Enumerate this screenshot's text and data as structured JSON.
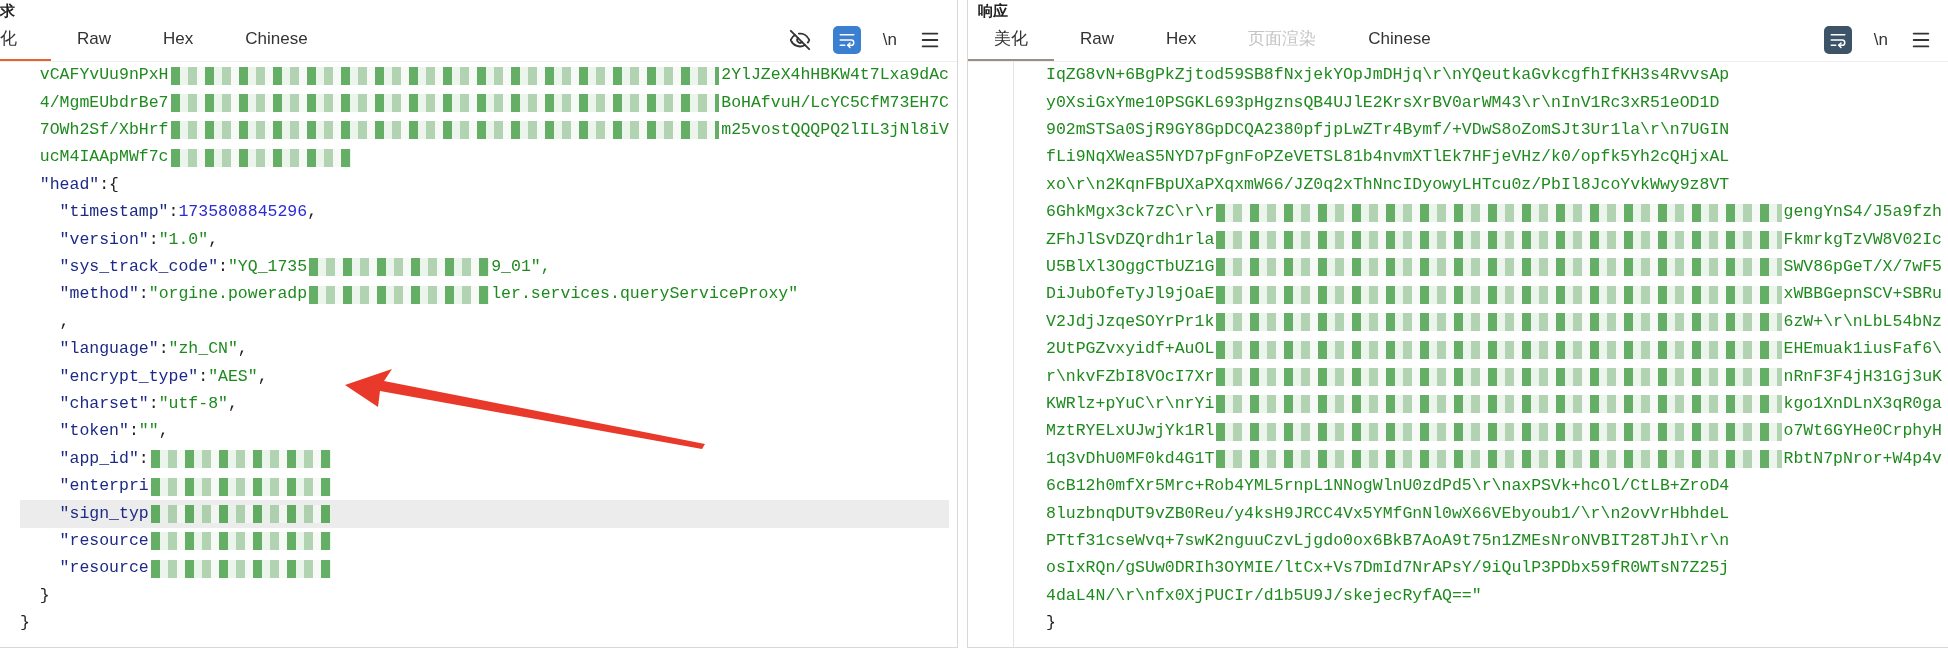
{
  "panels": [
    {
      "title": "求",
      "focused": true,
      "tabs": [
        {
          "label": "化",
          "selected": true,
          "disabled": false
        },
        {
          "label": "Raw",
          "selected": false,
          "disabled": false
        },
        {
          "label": "Hex",
          "selected": false,
          "disabled": false
        },
        {
          "label": "Chinese",
          "selected": false,
          "disabled": false
        }
      ],
      "toolbar": [
        {
          "kind": "eye"
        },
        {
          "kind": "wrap",
          "on": true
        },
        {
          "kind": "text",
          "text": "\\n"
        },
        {
          "kind": "menu"
        }
      ],
      "lines": [
        {
          "highlighted": false,
          "parts": [
            {
              "kind": "string",
              "text": "  vCAFYvUu9nPxH"
            },
            {
              "kind": "redacted"
            },
            {
              "kind": "string",
              "text": "2YlJZeX4hHBKW4t7Lxa9dAc"
            }
          ]
        },
        {
          "highlighted": false,
          "parts": [
            {
              "kind": "string",
              "text": "  4/MgmEUbdrBe7"
            },
            {
              "kind": "redacted"
            },
            {
              "kind": "string",
              "text": "BoHAfvuH/LcYC5CfM73EH7C"
            }
          ]
        },
        {
          "highlighted": false,
          "parts": [
            {
              "kind": "string",
              "text": "  7OWh2Sf/XbHrf"
            },
            {
              "kind": "redacted"
            },
            {
              "kind": "string",
              "text": "m25vostQQQPQ2lIL3jNl8iV"
            }
          ]
        },
        {
          "highlighted": false,
          "parts": [
            {
              "kind": "string",
              "text": "  ucM4IAApMWf7c"
            },
            {
              "kind": "redacted_short"
            }
          ]
        },
        {
          "highlighted": false,
          "parts": [
            {
              "kind": "key",
              "text": "  \"head\""
            },
            {
              "kind": "punct",
              "text": ":{"
            }
          ]
        },
        {
          "highlighted": false,
          "parts": [
            {
              "kind": "key",
              "text": "    \"timestamp\""
            },
            {
              "kind": "punct",
              "text": ":"
            },
            {
              "kind": "number",
              "text": "1735808845296"
            },
            {
              "kind": "punct",
              "text": ","
            }
          ]
        },
        {
          "highlighted": false,
          "parts": [
            {
              "kind": "key",
              "text": "    \"version\""
            },
            {
              "kind": "punct",
              "text": ":"
            },
            {
              "kind": "string",
              "text": "\"1.0\""
            },
            {
              "kind": "punct",
              "text": ","
            }
          ]
        },
        {
          "highlighted": false,
          "parts": [
            {
              "kind": "key",
              "text": "    \"sys_track_code\""
            },
            {
              "kind": "punct",
              "text": ":"
            },
            {
              "kind": "string",
              "text": "\"YQ_1735"
            },
            {
              "kind": "redacted_short"
            },
            {
              "kind": "string",
              "text": "9_01\","
            }
          ]
        },
        {
          "highlighted": false,
          "parts": [
            {
              "kind": "key",
              "text": "    \"method\""
            },
            {
              "kind": "punct",
              "text": ":"
            },
            {
              "kind": "string",
              "text": "\"orgine.poweradp"
            },
            {
              "kind": "redacted_short"
            },
            {
              "kind": "string",
              "text": "ler.services.queryServiceProxy\""
            }
          ]
        },
        {
          "highlighted": false,
          "parts": [
            {
              "kind": "punct",
              "text": "    ,"
            }
          ]
        },
        {
          "highlighted": false,
          "parts": [
            {
              "kind": "key",
              "text": "    \"language\""
            },
            {
              "kind": "punct",
              "text": ":"
            },
            {
              "kind": "string",
              "text": "\"zh_CN\""
            },
            {
              "kind": "punct",
              "text": ","
            }
          ]
        },
        {
          "highlighted": false,
          "parts": [
            {
              "kind": "key",
              "text": "    \"encrypt_type\""
            },
            {
              "kind": "punct",
              "text": ":"
            },
            {
              "kind": "string",
              "text": "\"AES\""
            },
            {
              "kind": "punct",
              "text": ","
            }
          ]
        },
        {
          "highlighted": false,
          "parts": [
            {
              "kind": "key",
              "text": "    \"charset\""
            },
            {
              "kind": "punct",
              "text": ":"
            },
            {
              "kind": "string",
              "text": "\"utf-8\""
            },
            {
              "kind": "punct",
              "text": ","
            }
          ]
        },
        {
          "highlighted": false,
          "parts": [
            {
              "kind": "key",
              "text": "    \"token\""
            },
            {
              "kind": "punct",
              "text": ":"
            },
            {
              "kind": "string",
              "text": "\"\""
            },
            {
              "kind": "punct",
              "text": ","
            }
          ]
        },
        {
          "highlighted": false,
          "parts": [
            {
              "kind": "key",
              "text": "    \"app_id\""
            },
            {
              "kind": "punct",
              "text": ":"
            },
            {
              "kind": "redacted_short"
            }
          ]
        },
        {
          "highlighted": false,
          "parts": [
            {
              "kind": "key",
              "text": "    \"enterpri"
            },
            {
              "kind": "redacted_short"
            }
          ]
        },
        {
          "highlighted": true,
          "parts": [
            {
              "kind": "key",
              "text": "    \"sign_typ"
            },
            {
              "kind": "redacted_short"
            }
          ]
        },
        {
          "highlighted": false,
          "parts": [
            {
              "kind": "key",
              "text": "    \"resource"
            },
            {
              "kind": "redacted_short"
            }
          ]
        },
        {
          "highlighted": false,
          "parts": [
            {
              "kind": "key",
              "text": "    \"resource"
            },
            {
              "kind": "redacted_short"
            }
          ]
        },
        {
          "highlighted": false,
          "parts": [
            {
              "kind": "punct",
              "text": "  }"
            }
          ]
        },
        {
          "highlighted": false,
          "parts": [
            {
              "kind": "punct",
              "text": "}"
            }
          ]
        }
      ]
    },
    {
      "title": "响应",
      "focused": false,
      "tabs": [
        {
          "label": "美化",
          "selected": true,
          "disabled": false
        },
        {
          "label": "Raw",
          "selected": false,
          "disabled": false
        },
        {
          "label": "Hex",
          "selected": false,
          "disabled": false
        },
        {
          "label": "页面渲染",
          "selected": false,
          "disabled": true
        },
        {
          "label": "Chinese",
          "selected": false,
          "disabled": false
        }
      ],
      "toolbar": [
        {
          "kind": "wrap",
          "on": true
        },
        {
          "kind": "text",
          "text": "\\n"
        },
        {
          "kind": "menu"
        }
      ],
      "lines": [
        {
          "highlighted": false,
          "parts": [
            {
              "kind": "string",
              "text": "IqZG8vN+6BgPkZjtod59SB8fNxjekYOpJmDHjq\\r\\nYQeutkaGvkcgfhIfKH3s4RvvsAp"
            }
          ]
        },
        {
          "highlighted": false,
          "parts": [
            {
              "kind": "string",
              "text": "y0XsiGxYme10PSGKL693pHgznsQB4UJlE2KrsXrBV0arWM43\\r\\nInV1Rc3xR51eOD1D"
            }
          ]
        },
        {
          "highlighted": false,
          "parts": [
            {
              "kind": "string",
              "text": "902mSTSa0SjR9GY8GpDCQA2380pfjpLwZTr4Bymf/+VDwS8oZomSJt3Ur1la\\r\\n7UGIN"
            }
          ]
        },
        {
          "highlighted": false,
          "parts": [
            {
              "kind": "string",
              "text": "fLi9NqXWeaS5NYD7pFgnFoPZeVETSL81b4nvmXTlEk7HFjeVHz/k0/opfk5Yh2cQHjxAL"
            }
          ]
        },
        {
          "highlighted": false,
          "parts": [
            {
              "kind": "string",
              "text": "xo\\r\\n2KqnFBpUXaPXqxmW66/JZ0q2xThNncIDyowyLHTcu0z/PbIl8JcoYvkWwy9z8VT"
            }
          ]
        },
        {
          "highlighted": false,
          "parts": [
            {
              "kind": "string",
              "text": "6GhkMgx3ck7zC\\r\\r"
            },
            {
              "kind": "redacted"
            },
            {
              "kind": "string",
              "text": "gengYnS4/J5a9fzh"
            }
          ]
        },
        {
          "highlighted": false,
          "parts": [
            {
              "kind": "string",
              "text": "ZFhJlSvDZQrdh1rla"
            },
            {
              "kind": "redacted"
            },
            {
              "kind": "string",
              "text": "FkmrkgTzVW8V02Ic"
            }
          ]
        },
        {
          "highlighted": false,
          "parts": [
            {
              "kind": "string",
              "text": "U5BlXl3OggCTbUZ1G"
            },
            {
              "kind": "redacted"
            },
            {
              "kind": "string",
              "text": "SWV86pGeT/X/7wF5"
            }
          ]
        },
        {
          "highlighted": false,
          "parts": [
            {
              "kind": "string",
              "text": "DiJubOfeTyJl9jOaE"
            },
            {
              "kind": "redacted"
            },
            {
              "kind": "string",
              "text": "xWBBGepnSCV+SBRu"
            }
          ]
        },
        {
          "highlighted": false,
          "parts": [
            {
              "kind": "string",
              "text": "V2JdjJzqeSOYrPr1k"
            },
            {
              "kind": "redacted"
            },
            {
              "kind": "string",
              "text": "6zW+\\r\\nLbL54bNz"
            }
          ]
        },
        {
          "highlighted": false,
          "parts": [
            {
              "kind": "string",
              "text": "2UtPGZvxyidf+AuOL"
            },
            {
              "kind": "redacted"
            },
            {
              "kind": "string",
              "text": "EHEmuak1iusFaf6\\"
            }
          ]
        },
        {
          "highlighted": false,
          "parts": [
            {
              "kind": "string",
              "text": "r\\nkvFZbI8VOcI7Xr"
            },
            {
              "kind": "redacted"
            },
            {
              "kind": "string",
              "text": "nRnF3F4jH31Gj3uK"
            }
          ]
        },
        {
          "highlighted": false,
          "parts": [
            {
              "kind": "string",
              "text": "KWRlz+pYuC\\r\\nrYi"
            },
            {
              "kind": "redacted"
            },
            {
              "kind": "string",
              "text": "kgo1XnDLnX3qR0ga"
            }
          ]
        },
        {
          "highlighted": false,
          "parts": [
            {
              "kind": "string",
              "text": "MztRYELxUJwjYk1Rl"
            },
            {
              "kind": "redacted"
            },
            {
              "kind": "string",
              "text": "o7Wt6GYHe0CrphyH"
            }
          ]
        },
        {
          "highlighted": false,
          "parts": [
            {
              "kind": "string",
              "text": "1q3vDhU0MF0kd4G1T"
            },
            {
              "kind": "redacted"
            },
            {
              "kind": "string",
              "text": "RbtN7pNror+W4p4v"
            }
          ]
        },
        {
          "highlighted": false,
          "parts": [
            {
              "kind": "string",
              "text": "6cB12h0mfXr5Mrc+Rob4YML5rnpL1NNogWlnU0zdPd5\\r\\naxPSVk+hcOl/CtLB+ZroD4"
            }
          ]
        },
        {
          "highlighted": false,
          "parts": [
            {
              "kind": "string",
              "text": "8luzbnqDUT9vZB0Reu/y4ksH9JRCC4Vx5YMfGnNl0wX66VEbyoub1/\\r\\n2ovVrHbhdeL"
            }
          ]
        },
        {
          "highlighted": false,
          "parts": [
            {
              "kind": "string",
              "text": "PTtf31cseWvq+7swK2nguuCzvLjgdo0ox6BkB7AoA9t75n1ZMEsNroNVBIT28TJhI\\r\\n"
            }
          ]
        },
        {
          "highlighted": false,
          "parts": [
            {
              "kind": "string",
              "text": "osIxRQn/gSUw0DRIh3OYMIE/ltCx+Vs7DmId7NrAPsY/9iQulP3PDbx59fR0WTsN7Z25j"
            }
          ]
        },
        {
          "highlighted": false,
          "parts": [
            {
              "kind": "string",
              "text": "4daL4N/\\r\\nfx0XjPUCIr/d1b5U9J/skejecRyfAQ==\""
            }
          ]
        },
        {
          "highlighted": false,
          "parts": [
            {
              "kind": "punct",
              "text": "}"
            }
          ]
        }
      ]
    }
  ]
}
